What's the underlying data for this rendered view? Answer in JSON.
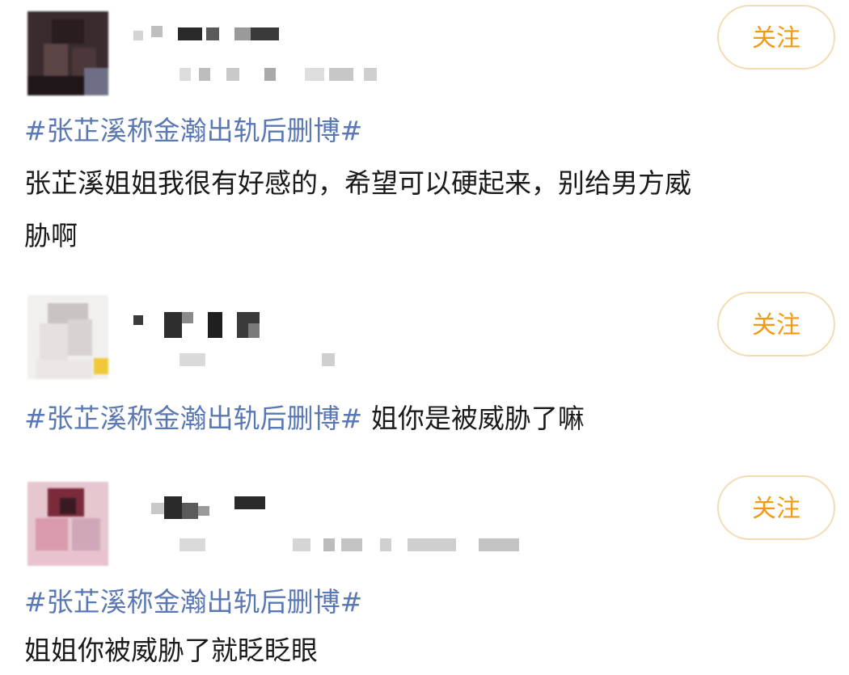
{
  "posts": [
    {
      "follow_label": "关注",
      "hashtag": "#张芷溪称金瀚出轨后删博#",
      "text_line1": "张芷溪姐姐我很有好感的，希望可以硬起来，别给男方威",
      "text_line2": "胁啊"
    },
    {
      "follow_label": "关注",
      "hashtag": "#张芷溪称金瀚出轨后删博#",
      "text_inline": "姐你是被威胁了嘛"
    },
    {
      "follow_label": "关注",
      "hashtag": "#张芷溪称金瀚出轨后删博#",
      "text_line1": "姐姐你被威胁了就眨眨眼"
    }
  ],
  "colors": {
    "hashtag": "#5a78b4",
    "follow_text": "#f29a12",
    "follow_border": "#f3dcb1",
    "body_text": "#1a1a1a"
  }
}
